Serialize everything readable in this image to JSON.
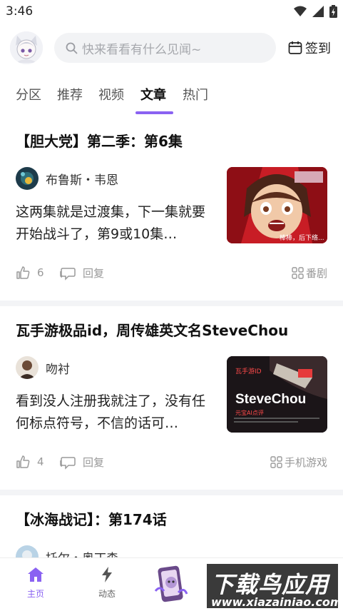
{
  "status_bar": {
    "time": "3:46"
  },
  "header": {
    "search_placeholder": "快来看看有什么见闻~",
    "checkin_label": "签到"
  },
  "tabs": [
    {
      "label": "分区",
      "active": false
    },
    {
      "label": "推荐",
      "active": false
    },
    {
      "label": "视频",
      "active": false
    },
    {
      "label": "文章",
      "active": true
    },
    {
      "label": "热门",
      "active": false
    }
  ],
  "posts": [
    {
      "title": "【胆大党】第二季：第6集",
      "author": "布鲁斯・韦恩",
      "excerpt": "这两集就是过渡集，下一集就要开始战斗了，第9或10集…",
      "thumb_caption": "棒棒，后下络...",
      "likes": "6",
      "reply_label": "回复",
      "tag": "番剧"
    },
    {
      "title": "瓦手游极品id，周传雄英文名SteveChou",
      "author": "吻衬",
      "excerpt": "看到没人注册我就注了，没有任何标点符号，不信的话可…",
      "thumb_line1": "瓦手游ID",
      "thumb_big": "SteveChou",
      "thumb_line2": "元宝AI点评",
      "likes": "4",
      "reply_label": "回复",
      "tag": "手机游戏"
    },
    {
      "title": "【冰海战记】：第174话",
      "author": "托尔・奥丁森"
    }
  ],
  "bottom_nav": [
    {
      "label": "主页",
      "icon": "home-icon",
      "active": true
    },
    {
      "label": "动态",
      "icon": "lightning-icon",
      "active": false
    }
  ],
  "watermark": {
    "big": "下载鸟应用",
    "small": "www.xiazainiao.com"
  },
  "colors": {
    "accent": "#8a62f2",
    "text_secondary": "#999999"
  }
}
